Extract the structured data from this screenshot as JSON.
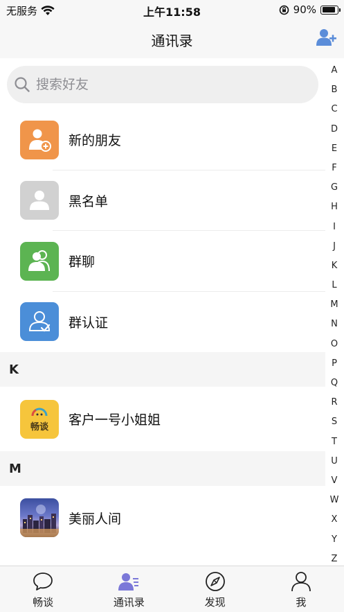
{
  "status_bar": {
    "carrier": "无服务",
    "time": "上午11:58",
    "battery_percent": "90%",
    "battery_level": 0.9
  },
  "nav": {
    "title": "通讯录"
  },
  "search": {
    "placeholder": "搜索好友"
  },
  "functions": [
    {
      "label": "新的朋友",
      "icon": "new-friend-icon",
      "color": "#f0954a"
    },
    {
      "label": "黑名单",
      "icon": "blacklist-icon",
      "color": "#d1d1d1"
    },
    {
      "label": "群聊",
      "icon": "group-chat-icon",
      "color": "#5cb452"
    },
    {
      "label": "群认证",
      "icon": "group-verify-icon",
      "color": "#4b8ed8"
    }
  ],
  "sections": [
    {
      "letter": "K",
      "contacts": [
        {
          "name": "客户一号小姐姐",
          "avatar_text": "畅谈"
        }
      ]
    },
    {
      "letter": "M",
      "contacts": [
        {
          "name": "美丽人间"
        }
      ]
    }
  ],
  "index_letters": [
    "A",
    "B",
    "C",
    "D",
    "E",
    "F",
    "G",
    "H",
    "I",
    "J",
    "K",
    "L",
    "M",
    "N",
    "O",
    "P",
    "Q",
    "R",
    "S",
    "T",
    "U",
    "V",
    "W",
    "X",
    "Y",
    "Z"
  ],
  "tabs": [
    {
      "label": "畅谈",
      "icon": "chat-bubble-icon",
      "active": false
    },
    {
      "label": "通讯录",
      "icon": "contacts-icon",
      "active": true
    },
    {
      "label": "发现",
      "icon": "compass-icon",
      "active": false
    },
    {
      "label": "我",
      "icon": "profile-icon",
      "active": false
    }
  ],
  "colors": {
    "accent": "#5b8dd9",
    "active_tab": "#7b78d8"
  }
}
